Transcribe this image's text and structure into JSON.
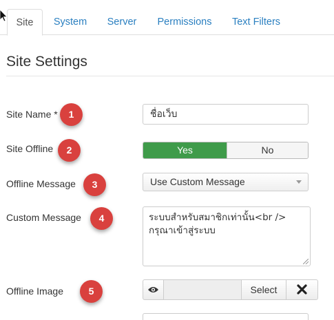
{
  "tabs": [
    {
      "label": "Site",
      "active": true
    },
    {
      "label": "System",
      "active": false
    },
    {
      "label": "Server",
      "active": false
    },
    {
      "label": "Permissions",
      "active": false
    },
    {
      "label": "Text Filters",
      "active": false
    }
  ],
  "section": {
    "title": "Site Settings"
  },
  "fields": {
    "site_name": {
      "label": "Site Name *",
      "badge": "1",
      "value": "ชื่อเว็บ"
    },
    "site_offline": {
      "label": "Site Offline",
      "badge": "2",
      "yes": "Yes",
      "no": "No",
      "selected": "Yes"
    },
    "offline_message": {
      "label": "Offline Message",
      "badge": "3",
      "value": "Use Custom Message"
    },
    "custom_message": {
      "label": "Custom Message",
      "badge": "4",
      "line1": "ระบบสำหรับสมาชิกเท่านั้น<br />",
      "line2": "กรุณาเข้าสู่ระบบ"
    },
    "offline_image": {
      "label": "Offline Image",
      "badge": "5",
      "select": "Select"
    }
  },
  "colors": {
    "accent": "#2a7fc0",
    "badge": "#d9413e",
    "toggle_yes": "#3f9b4a"
  },
  "icons": {
    "preview": "eye-icon",
    "clear": "close-icon",
    "cursor": "mouse-pointer-icon",
    "dropdown": "chevron-down-icon"
  }
}
